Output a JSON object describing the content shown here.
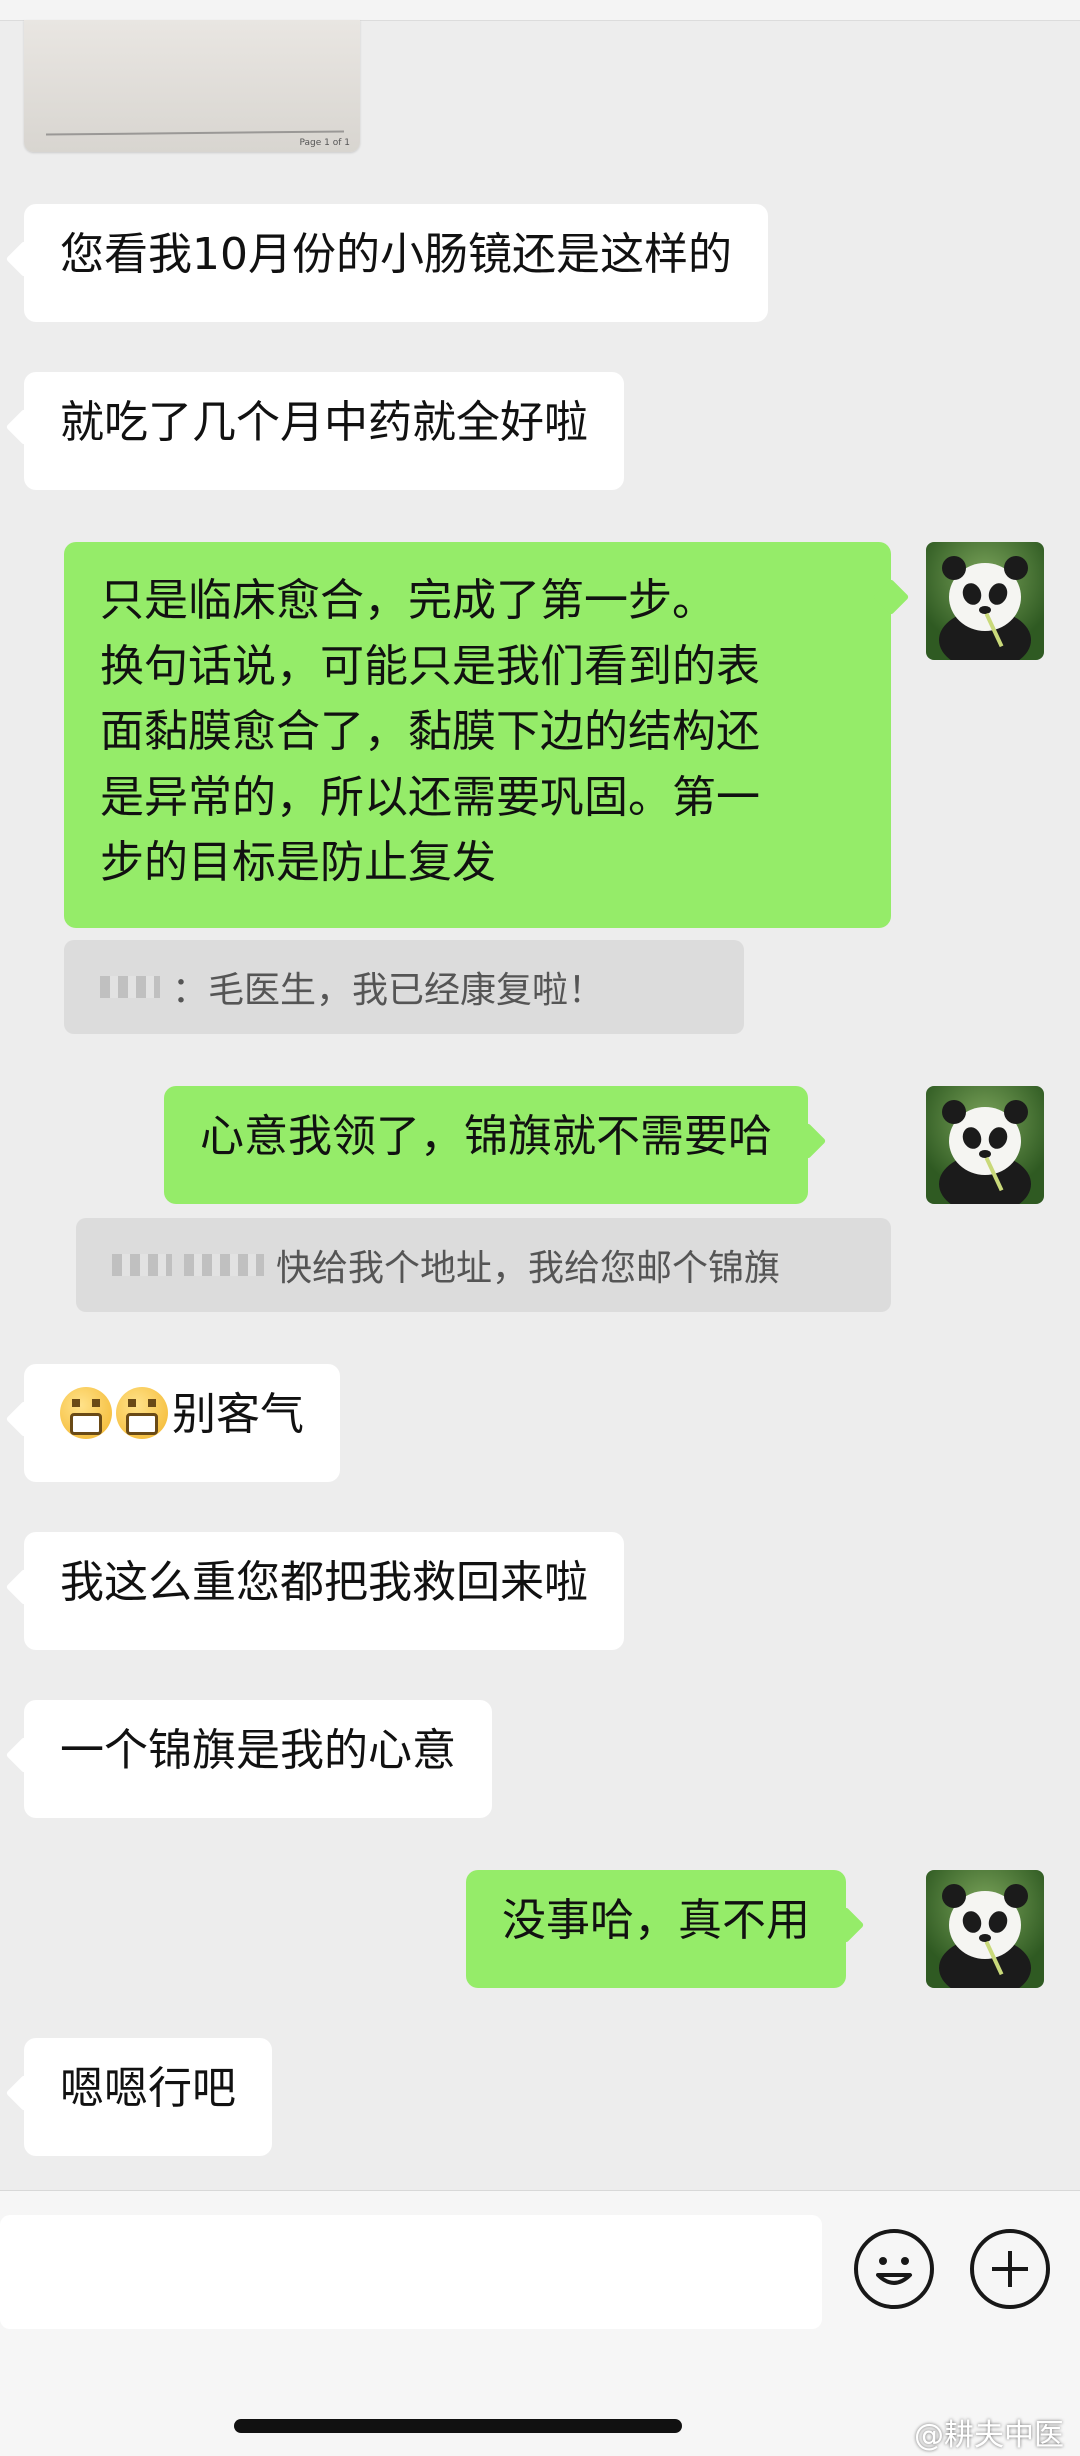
{
  "messages": {
    "m1": "您看我10月份的小肠镜还是这样的",
    "m2": "就吃了几个月中药就全好啦",
    "m3_lines": [
      "只是临床愈合，完成了第一步。",
      "换句话说，可能只是我们看到的表",
      "面黏膜愈合了，黏膜下边的结构还",
      "是异常的，所以还需要巩固。第一",
      "步的目标是防止复发"
    ],
    "q1": "：毛医生，我已经康复啦！",
    "m4": "心意我领了，锦旗就不需要哈",
    "q2": "快给我个地址，我给您邮个锦旗",
    "m5": "别客气",
    "m6": "我这么重您都把我救回来啦",
    "m7": "一个锦旗是我的心意",
    "m8": "没事哈，真不用",
    "m9": "嗯嗯行吧"
  },
  "icons": {
    "emoji": "grimacing-face-icon",
    "avatar": "panda-avatar",
    "emoji_button": "smiley-icon",
    "add_button": "plus-circle-icon"
  },
  "colors": {
    "background": "#ededed",
    "received_bubble": "#ffffff",
    "sent_bubble": "#95ec69",
    "quote_bg": "#dcdcdc"
  },
  "watermark": "@耕夫中医"
}
